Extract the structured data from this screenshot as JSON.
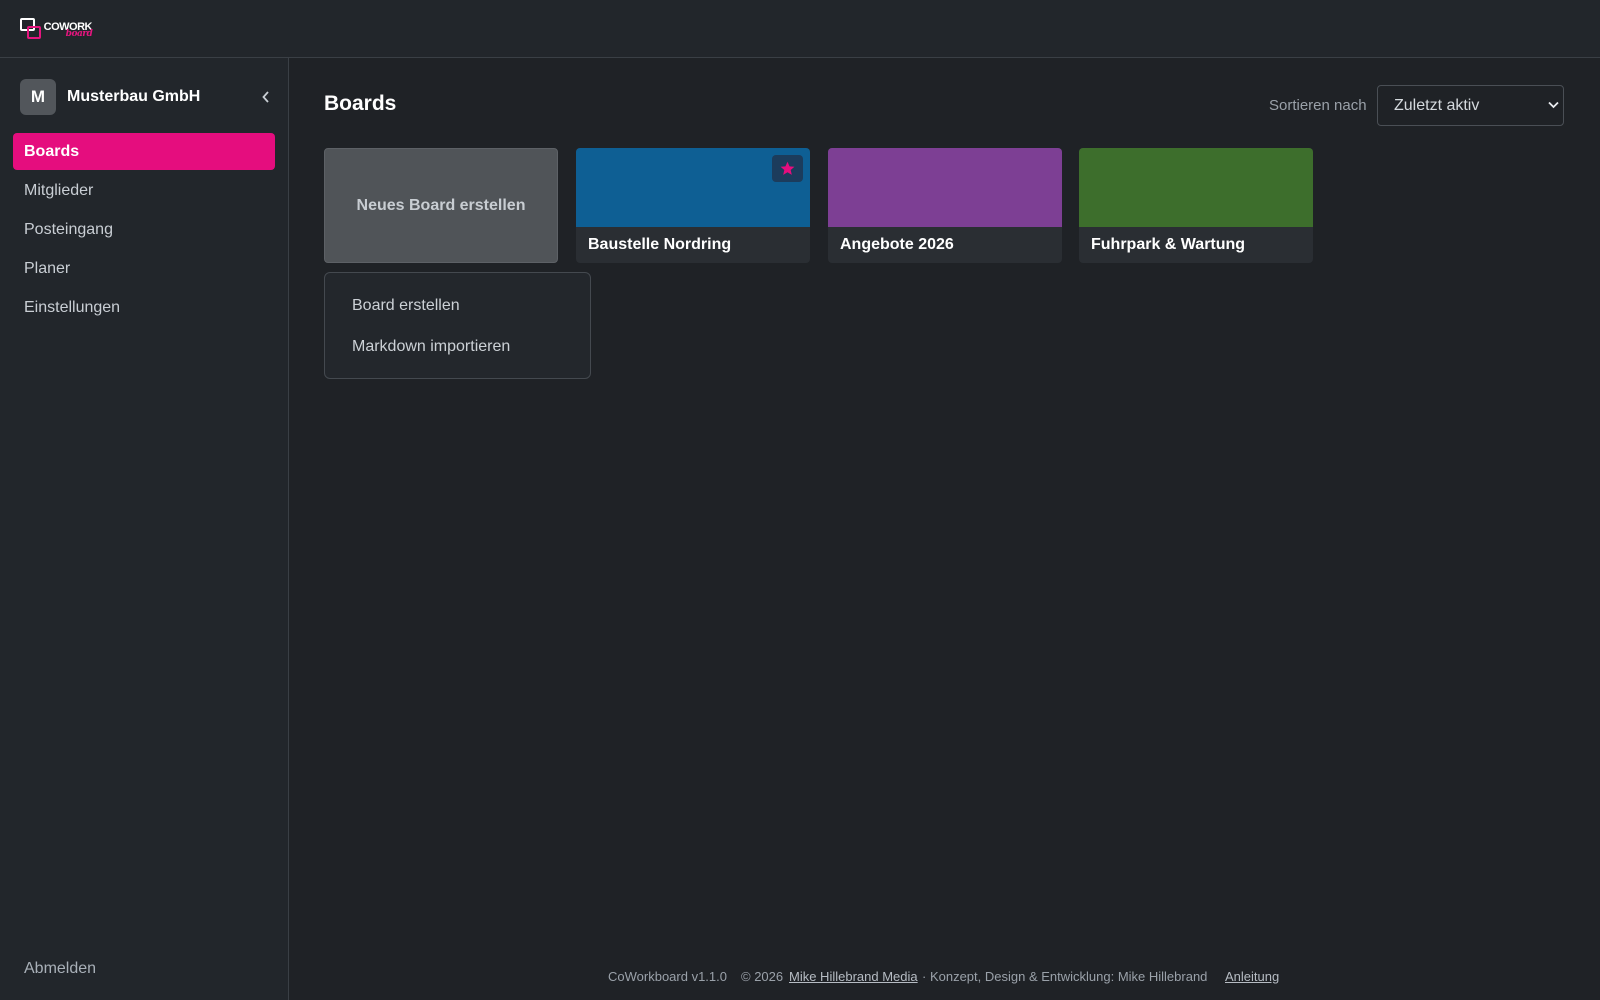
{
  "app": {
    "logo_text": "COWORK",
    "logo_sub": "board"
  },
  "sidebar": {
    "org_initial": "M",
    "org_name": "Musterbau GmbH",
    "items": [
      {
        "label": "Boards",
        "active": true
      },
      {
        "label": "Mitglieder",
        "active": false
      },
      {
        "label": "Posteingang",
        "active": false
      },
      {
        "label": "Planer",
        "active": false
      },
      {
        "label": "Einstellungen",
        "active": false
      }
    ],
    "logout_label": "Abmelden"
  },
  "main": {
    "title": "Boards",
    "sort_label": "Sortieren nach",
    "sort_value": "Zuletzt aktiv",
    "new_board_label": "Neues Board erstellen",
    "boards": [
      {
        "title": "Baustelle Nordring",
        "color": "#0e5f94",
        "starred": true
      },
      {
        "title": "Angebote 2026",
        "color": "#7d3f94",
        "starred": false
      },
      {
        "title": "Fuhrpark & Wartung",
        "color": "#3d6e2c",
        "starred": false
      }
    ],
    "new_board_menu": [
      "Board erstellen",
      "Markdown importieren"
    ]
  },
  "footer": {
    "version": "CoWorkboard v1.1.0",
    "copyright": "© 2026",
    "company_link": "Mike Hillebrand Media",
    "credits": "· Konzept, Design & Entwicklung: Mike Hillebrand",
    "help_link": "Anleitung"
  },
  "colors": {
    "accent": "#e50d7e",
    "background": "#1f2226",
    "sidebar": "#22262b"
  }
}
